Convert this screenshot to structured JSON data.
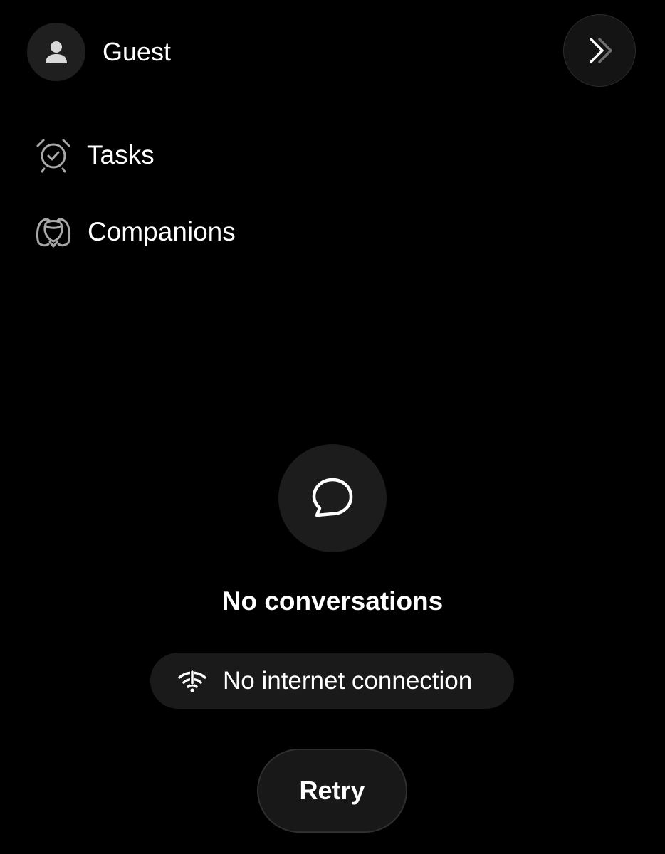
{
  "header": {
    "username": "Guest",
    "avatar_icon": "person-icon",
    "expand_icon": "double-chevron-right-icon"
  },
  "nav": {
    "items": [
      {
        "label": "Tasks",
        "icon": "alarm-check-icon"
      },
      {
        "label": "Companions",
        "icon": "companions-icon"
      }
    ]
  },
  "empty_state": {
    "icon": "chat-bubble-icon",
    "title": "No conversations"
  },
  "status": {
    "icon": "wifi-off-icon",
    "text": "No internet connection"
  },
  "actions": {
    "retry_label": "Retry"
  },
  "colors": {
    "background": "#000000",
    "surface": "#1c1c1c",
    "text": "#ffffff",
    "icon_muted": "#a8a8a8"
  }
}
